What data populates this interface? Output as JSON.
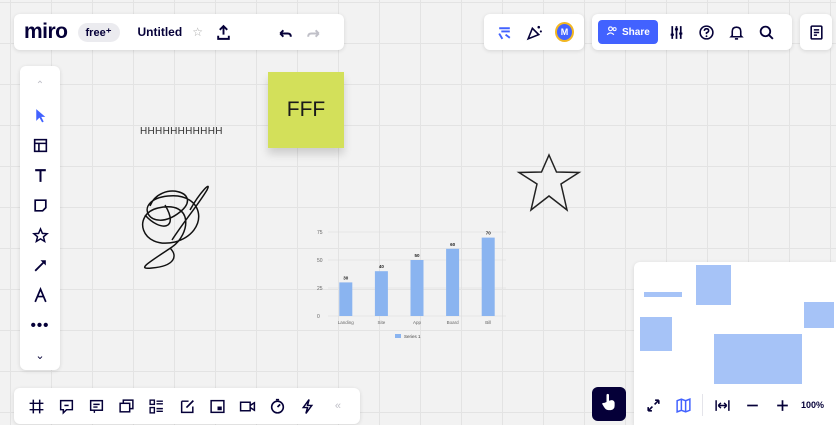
{
  "app": {
    "logo": "miro",
    "plan_badge": "free⁺",
    "board_name": "Untitled"
  },
  "toolbar_top": {
    "share_label": "Share",
    "avatar_initials": "M"
  },
  "canvas": {
    "sticky_note_text": "FFF",
    "text_item": "HHHHHHHHHHH"
  },
  "minimap": {
    "zoom": "100%"
  },
  "colors": {
    "accent": "#4262ff",
    "sticky": "#d3e05a",
    "bar": "#8ab4f0"
  },
  "chart_data": {
    "type": "bar",
    "categories": [
      "Landing",
      "Site",
      "App",
      "Board",
      "Bill"
    ],
    "series": [
      {
        "name": "Series 1",
        "values": [
          30,
          40,
          50,
          60,
          70
        ]
      }
    ],
    "yticks": [
      0,
      25,
      50,
      75
    ],
    "ylim": [
      0,
      75
    ],
    "grid": true,
    "legend_position": "bottom"
  }
}
